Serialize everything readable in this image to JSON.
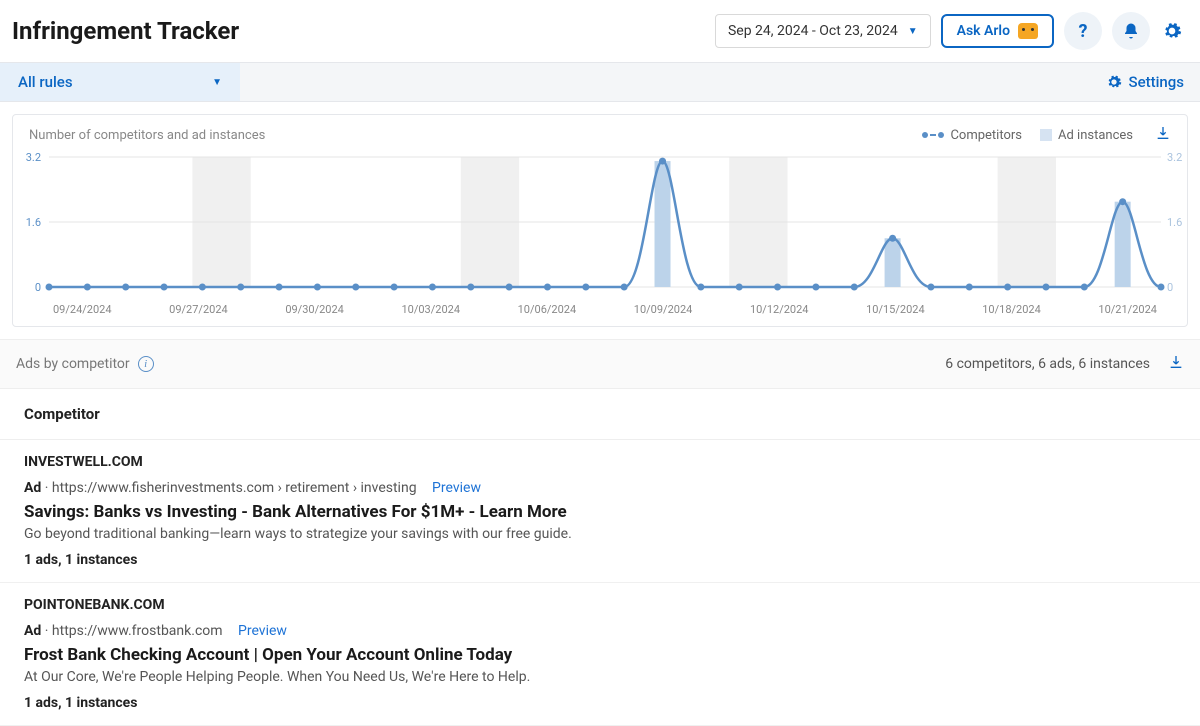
{
  "header": {
    "title": "Infringement Tracker",
    "date_range": "Sep 24, 2024 - Oct 23, 2024",
    "ask_arlo": "Ask Arlo"
  },
  "toolbar": {
    "rules_dropdown": "All rules",
    "settings": "Settings"
  },
  "chart": {
    "title": "Number of competitors and ad instances",
    "legend": {
      "competitors": "Competitors",
      "ad_instances": "Ad instances"
    },
    "y_ticks": [
      "0",
      "1.6",
      "3.2"
    ],
    "y_ticks_right": [
      "0",
      "1.6",
      "3.2"
    ]
  },
  "chart_data": {
    "type": "line",
    "title": "Number of competitors and ad instances",
    "xlabel": "",
    "ylabel": "",
    "ylim": [
      0,
      3.2
    ],
    "categories": [
      "09/24/2024",
      "09/25/2024",
      "09/26/2024",
      "09/27/2024",
      "09/28/2024",
      "09/29/2024",
      "09/30/2024",
      "10/01/2024",
      "10/02/2024",
      "10/03/2024",
      "10/04/2024",
      "10/05/2024",
      "10/06/2024",
      "10/07/2024",
      "10/08/2024",
      "10/09/2024",
      "10/10/2024",
      "10/11/2024",
      "10/12/2024",
      "10/13/2024",
      "10/14/2024",
      "10/15/2024",
      "10/16/2024",
      "10/17/2024",
      "10/18/2024",
      "10/19/2024",
      "10/20/2024",
      "10/21/2024",
      "10/22/2024",
      "10/23/2024"
    ],
    "x_tick_labels": [
      "09/24/2024",
      "09/27/2024",
      "09/30/2024",
      "10/03/2024",
      "10/06/2024",
      "10/09/2024",
      "10/12/2024",
      "10/15/2024",
      "10/18/2024",
      "10/21/2024"
    ],
    "series": [
      {
        "name": "Competitors",
        "kind": "line",
        "values": [
          0,
          0,
          0,
          0,
          0,
          0,
          0,
          0,
          0,
          0,
          0,
          0,
          0,
          0,
          0,
          0,
          3.1,
          0,
          0,
          0,
          0,
          0,
          1.2,
          0,
          0,
          0,
          0,
          0,
          2.1,
          0
        ]
      },
      {
        "name": "Ad instances",
        "kind": "bar",
        "values": [
          0,
          0,
          0,
          0,
          0,
          0,
          0,
          0,
          0,
          0,
          0,
          0,
          0,
          0,
          0,
          0,
          3.1,
          0,
          0,
          0,
          0,
          0,
          1.2,
          0,
          0,
          0,
          0,
          0,
          2.1,
          0
        ]
      }
    ],
    "weekend_bands": [
      [
        4,
        5
      ],
      [
        11,
        12
      ],
      [
        18,
        19
      ],
      [
        25,
        26
      ]
    ]
  },
  "summary": {
    "label": "Ads by competitor",
    "stats": "6 competitors, 6 ads, 6 instances"
  },
  "table": {
    "column_header": "Competitor",
    "rows": [
      {
        "name": "INVESTWELL.COM",
        "ad_prefix": "Ad",
        "url": "https://www.fisherinvestments.com › retirement › investing",
        "preview": "Preview",
        "title": "Savings: Banks vs Investing - Bank Alternatives For $1M+ - Learn More",
        "desc": "Go beyond traditional banking—learn ways to strategize your savings with our free guide.",
        "count": "1 ads, 1 instances"
      },
      {
        "name": "POINTONEBANK.COM",
        "ad_prefix": "Ad",
        "url": "https://www.frostbank.com",
        "preview": "Preview",
        "title": "Frost Bank Checking Account | Open Your Account Online Today",
        "desc": "At Our Core, We're People Helping People. When You Need Us, We're Here to Help.",
        "count": "1 ads, 1 instances"
      }
    ]
  }
}
